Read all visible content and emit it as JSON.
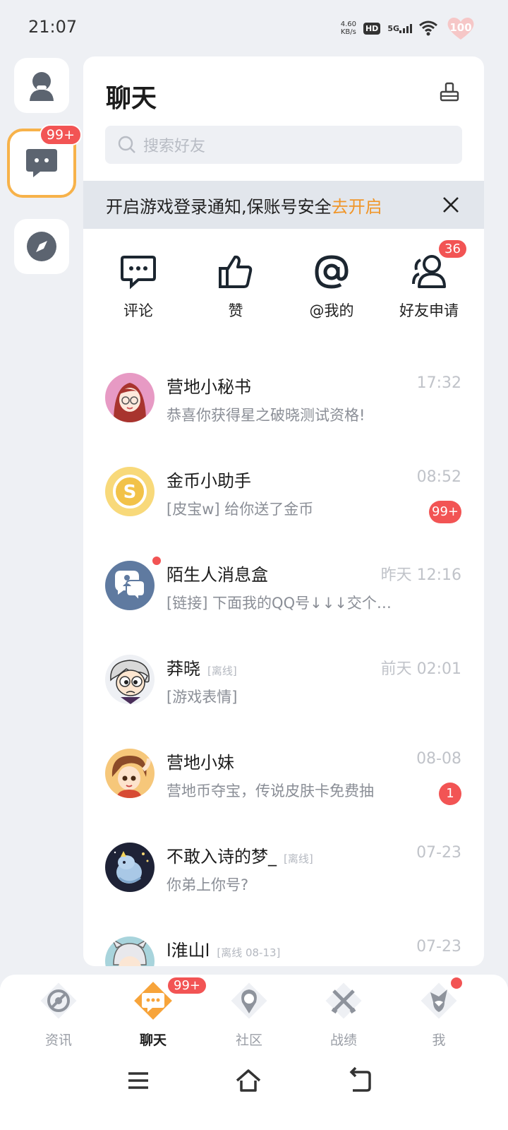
{
  "status_bar": {
    "time": "21:07",
    "net_speed_value": "4.60",
    "net_speed_unit": "KB/s",
    "hd": "HD",
    "signal": "5G",
    "battery": "100"
  },
  "left_rail": {
    "chat_badge": "99+"
  },
  "panel": {
    "title": "聊天",
    "search_placeholder": "搜索好友",
    "notice_text": "开启游戏登录通知,保账号安全",
    "notice_link": "去开启"
  },
  "quick_actions": [
    {
      "label": "评论",
      "icon": "comment-icon"
    },
    {
      "label": "赞",
      "icon": "thumbs-up-icon"
    },
    {
      "label": "@我的",
      "icon": "at-icon"
    },
    {
      "label": "好友申请",
      "icon": "friend-request-icon",
      "badge": "36"
    }
  ],
  "chats": [
    {
      "name": "营地小秘书",
      "time": "17:32",
      "preview": "恭喜你获得星之破晓测试资格!",
      "offline": "",
      "badge": ""
    },
    {
      "name": "金币小助手",
      "time": "08:52",
      "preview": "[皮宝w] 给你送了金币",
      "offline": "",
      "badge": "99+"
    },
    {
      "name": "陌生人消息盒",
      "time": "昨天 12:16",
      "preview": "[链接] 下面我的QQ号↓↓↓交个…",
      "offline": "",
      "badge": ""
    },
    {
      "name": "莽晓",
      "time": "前天 02:01",
      "preview": "[游戏表情]",
      "offline": "[离线]",
      "badge": ""
    },
    {
      "name": "营地小妹",
      "time": "08-08",
      "preview": "营地币夺宝，传说皮肤卡免费抽",
      "offline": "",
      "badge": "1"
    },
    {
      "name": "不敢入诗的梦_",
      "time": "07-23",
      "preview": "你弟上你号?",
      "offline": "[离线]",
      "badge": ""
    },
    {
      "name": "l淮山l",
      "time": "07-23",
      "preview": "",
      "offline": "[离线 08-13]",
      "badge": ""
    }
  ],
  "bottom_nav": [
    {
      "label": "资讯",
      "icon": "news-icon"
    },
    {
      "label": "聊天",
      "icon": "chat-icon",
      "badge": "99+"
    },
    {
      "label": "社区",
      "icon": "community-icon"
    },
    {
      "label": "战绩",
      "icon": "battle-record-icon"
    },
    {
      "label": "我",
      "icon": "profile-icon"
    }
  ],
  "colors": {
    "accent": "#f0962a",
    "badge_red": "#f25454",
    "rail_active_border": "#f7b24a",
    "background": "#eef0f4"
  }
}
